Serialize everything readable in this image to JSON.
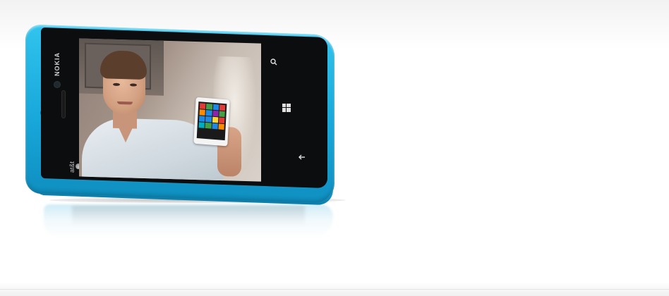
{
  "device": {
    "brand_text": "NOKIA",
    "carrier_text": "at&t",
    "body_color": "#1fb3e4",
    "nav_icons": [
      "search-icon",
      "windows-icon",
      "back-arrow-icon"
    ]
  },
  "screen": {
    "mini_phone_tiles": [
      "#e53935",
      "#43a047",
      "#1e88e5",
      "#e53935",
      "#fb8c00",
      "#1e88e5",
      "#8e24aa",
      "#43a047",
      "#1e88e5",
      "#1e88e5",
      "#fdd835",
      "#e53935",
      "#00acc1",
      "#43a047",
      "#1e88e5",
      "#fb8c00"
    ]
  }
}
